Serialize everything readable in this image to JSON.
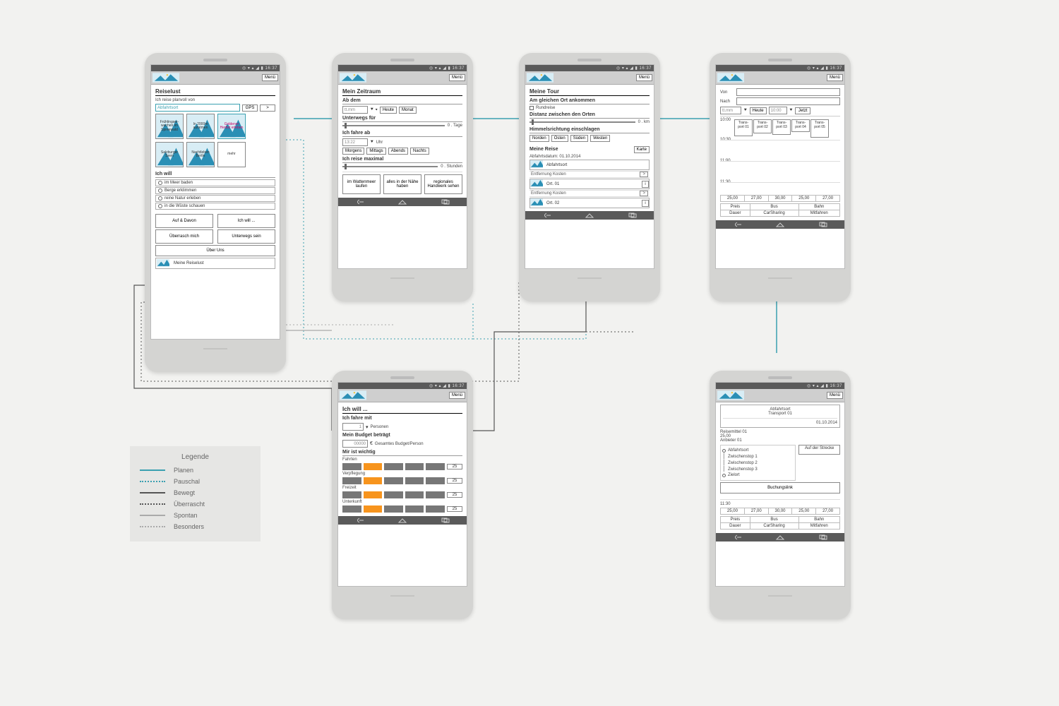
{
  "status_time": "16:37",
  "status_icons": "◎ ▾ ▴ ◢ ▮",
  "menu": "Menü",
  "legend": {
    "title": "Legende",
    "items": [
      {
        "label": "Planen",
        "style": "solid",
        "color": "#3aa0b0"
      },
      {
        "label": "Pauschal",
        "style": "dotted",
        "color": "#3aa0b0"
      },
      {
        "label": "Bewegt",
        "style": "solid",
        "color": "#555"
      },
      {
        "label": "Überrascht",
        "style": "dotted",
        "color": "#555"
      },
      {
        "label": "Spontan",
        "style": "solid",
        "color": "#aaa"
      },
      {
        "label": "Besonders",
        "style": "dotted",
        "color": "#aaa"
      }
    ]
  },
  "s1": {
    "title": "Reiselust",
    "sub": "Ich reise planvoll von",
    "ph": "Abfahrtsort",
    "gps": "GPS",
    "go": ">",
    "tiles": [
      "Frühlingser-wachen im Spreewald",
      "In 2000m aufatmen",
      "Goldener Herbst erleben",
      "Salzburger Seen",
      "Nachtleben Berlin",
      "mehr"
    ],
    "want": "Ich will",
    "opts": [
      "im Meer baden",
      "Berge erklimmen",
      "reine Natur erleben",
      "in die Wüste schauen"
    ],
    "b1": "Auf & Davon",
    "b2": "Ich will ...",
    "b3": "Überrasch mich",
    "b4": "Unterwegs sein",
    "about": "Über Uns",
    "mine": "Meine Reiselust"
  },
  "s2": {
    "title": "Mein Zeitraum",
    "ab": "Ab dem",
    "date": "tt.mm",
    "heute": "Heute",
    "monat": "Monat",
    "unterwegs": "Unterwegs für",
    "tage": "0 . Tage",
    "fahre": "Ich fahre ab",
    "time": "13:22",
    "uhr": "Uhr",
    "slots": [
      "Morgens",
      "Mittags",
      "Abends",
      "Nachts"
    ],
    "max": "Ich reise maximal",
    "std": "0 . Stunden",
    "btns": [
      "im Wattenmeer laufen",
      "alles in der Nähe haben",
      "regionales Handwerk sehen"
    ]
  },
  "s3": {
    "title": "Meine Tour",
    "same": "Am gleichen Ort ankommen",
    "rund": "Rundreise",
    "dist": "Distanz zwischen den Orten",
    "km": "0 . km",
    "dir": "Himmelsrichtung einschlagen",
    "dirs": [
      "Norden",
      "Osten",
      "Süden",
      "Westen"
    ],
    "reise": "Meine Reise",
    "karte": "Karte",
    "datum": "Abfahrtsdatum: 01.10.2014",
    "ort0": "Abfahrtsort",
    "ort1": "Ort. 01",
    "ort2": "Ort. 02",
    "ek": "Entfernung   Kosten"
  },
  "s4": {
    "von": "Von",
    "nach": "Nach",
    "date": "tt.mm",
    "heute": "Heute",
    "t": "10:00",
    "jetzt": "Jetzt",
    "times": [
      "10:00",
      "10:30",
      "11:00",
      "11:30"
    ],
    "trans": [
      "Trans-port 01",
      "Trans-port 02",
      "Trans-port 03",
      "Trans-port 04",
      "Trans-port 05"
    ],
    "prices": [
      "25,00",
      "27,00",
      "30,00",
      "25,00",
      "27,00"
    ],
    "row1": [
      "Preis",
      "Bus",
      "Bahn"
    ],
    "row2": [
      "Dauer",
      "CarSharing",
      "Mitfahren"
    ]
  },
  "s5": {
    "title": "Ich will ...",
    "fahre": "Ich fahre mit",
    "pers": "Personen",
    "num": "1",
    "budget": "Mein Budget beträgt",
    "val": "00000",
    "cur": "€",
    "note": "Gesamtes Budget/Person",
    "wichtig": "Mir ist wichtig",
    "sliders": [
      {
        "l": "Fahrten",
        "v": "25"
      },
      {
        "l": "Verpflegung",
        "v": "25"
      },
      {
        "l": "Freizeit",
        "v": "25"
      },
      {
        "l": "Unterkunft",
        "v": "25"
      }
    ]
  },
  "s6": {
    "head1": "Abfahrtsort",
    "head2": "Transport 01",
    "date": "01.10.2014",
    "rm": "Reisemittel 01",
    "price": "25,00",
    "anb": "Anbieter 01",
    "stops": [
      "Abfahrtsort",
      "Zwischenstop 1",
      "Zwischenstop 2",
      "Zwischenstop 3",
      "Zielort"
    ],
    "auf": "Auf der Strecke",
    "link": "Buchungslink",
    "t": "11:30",
    "prices": [
      "25,00",
      "27,00",
      "30,00",
      "25,00",
      "27,00"
    ],
    "row1": [
      "Preis",
      "Bus",
      "Bahn"
    ],
    "row2": [
      "Dauer",
      "CarSharing",
      "Mitfahren"
    ]
  }
}
